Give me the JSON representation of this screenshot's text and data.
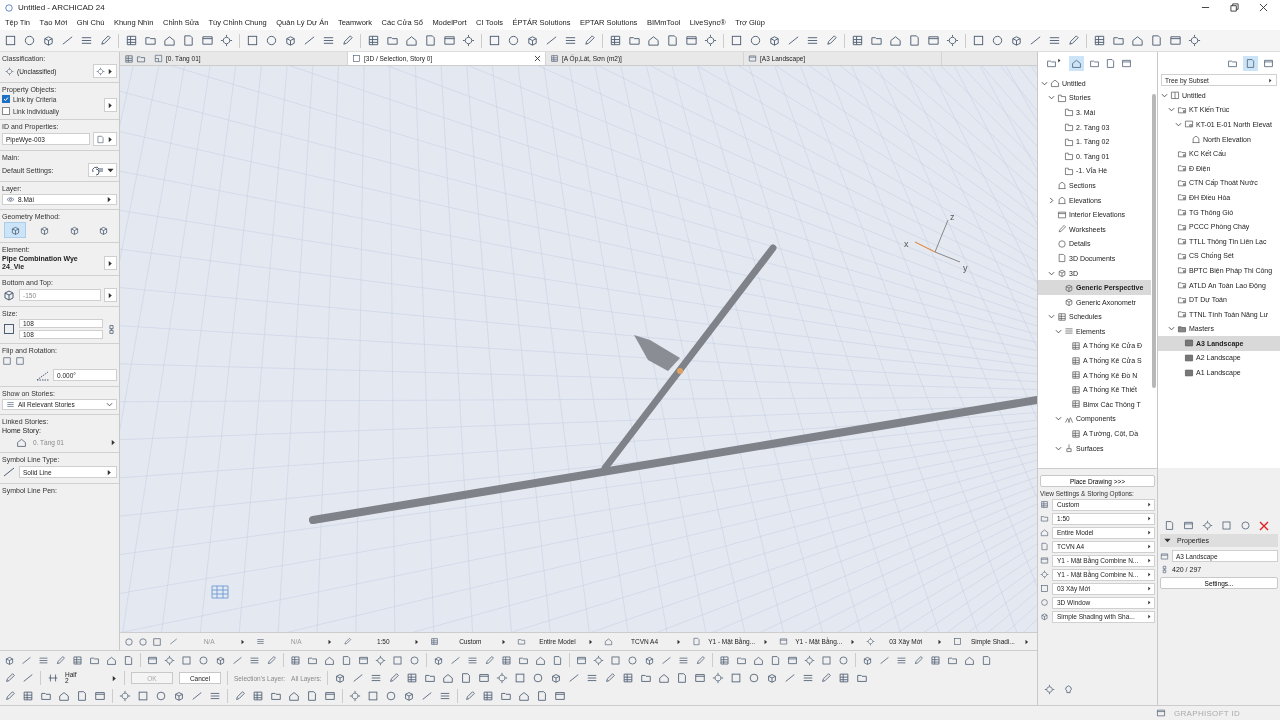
{
  "window": {
    "title": "Untitled - ARCHICAD 24"
  },
  "menu": [
    "Tệp Tin",
    "Tạo Mới",
    "Ghi Chú",
    "Khung Nhìn",
    "Chỉnh Sửa",
    "Tùy Chỉnh Chung",
    "Quản Lý Dự Án",
    "Teamwork",
    "Các Cửa Sổ",
    "ModelPort",
    "CI Tools",
    "ÉPTÁR Solutions",
    "EPTAR Solutions",
    "BIMmTool",
    "LiveSync®",
    "Trợ Giúp"
  ],
  "view_tabs": [
    {
      "label": "[0. Tầng 01]",
      "kind": "plan",
      "selected": false
    },
    {
      "label": "[3D / Selection, Story 0]",
      "kind": "perspective",
      "selected": true
    },
    {
      "label": "[A Ốp,Lát, Sơn (m2)]",
      "kind": "schedule",
      "selected": false
    },
    {
      "label": "[A3 Landscape]",
      "kind": "layout",
      "selected": false
    }
  ],
  "info_box": {
    "classification_label": "Classification:",
    "classification_value": "(Unclassified)",
    "property_objects_label": "Property Objects:",
    "links": [
      {
        "label": "Link by Criteria",
        "checked": true
      },
      {
        "label": "Link Individually",
        "checked": false
      }
    ],
    "id_label": "ID and Properties:",
    "id_value": "PipeWye-003",
    "main_label": "Main:",
    "default_settings_label": "Default Settings:",
    "layer_label": "Layer:",
    "layer_value": "8.Mái",
    "geometry_label": "Geometry Method:",
    "geometry_methods": [
      {
        "selected": true
      },
      {
        "selected": false
      },
      {
        "selected": false
      },
      {
        "selected": false
      }
    ],
    "element_label": "Element:",
    "element_value": "Pipe Combination Wye 24_Vie",
    "bottom_top_label": "Bottom and Top:",
    "bottom_top_value": "-150",
    "size_label": "Size:",
    "size_values": [
      "108",
      "108"
    ],
    "flip_label": "Flip and Rotation:",
    "rotation_value": "0.000°",
    "show_on_stories_label": "Show on Stories:",
    "show_on_stories_value": "All Relevant Stories",
    "linked_stories_label": "Linked Stories:",
    "home_story_label": "Home Story:",
    "home_story_value": "0. Tầng 01",
    "symbol_line_type_label": "Symbol Line Type:",
    "symbol_line_type_value": "Solid Line",
    "symbol_line_pen_label": "Symbol Line Pen:"
  },
  "viewport": {
    "axis_labels": [
      "z",
      "x",
      "y"
    ]
  },
  "quick_options": [
    "N/A",
    "N/A",
    "1:50",
    "Custom",
    "Entire Model",
    "TCVN A4",
    "Y1 - Mặt Bằng...",
    "Y1 - Mặt Bằng...",
    "03 Xây Mới",
    "Simple Shadi..."
  ],
  "pen_option": {
    "label": "Half",
    "value": "2"
  },
  "confirm_buttons": [
    {
      "label": "OK",
      "disabled": true
    },
    {
      "label": "Cancel",
      "disabled": false
    }
  ],
  "layer_labels": [
    "Selection's Layer:",
    "All Layers:"
  ],
  "navigator": {
    "tree": [
      {
        "label": "Untitled",
        "kind": "project",
        "expanded": true,
        "selected": false,
        "children": [
          {
            "label": "Stories",
            "kind": "story",
            "expanded": true,
            "selected": false,
            "children": [
              {
                "label": "3. Mái",
                "kind": "story",
                "selected": false
              },
              {
                "label": "2. Tầng 03",
                "kind": "story",
                "selected": false
              },
              {
                "label": "1. Tầng 02",
                "kind": "story",
                "selected": false
              },
              {
                "label": "0. Tầng 01",
                "kind": "story",
                "selected": false
              },
              {
                "label": "-1. Vỉa Hè",
                "kind": "story",
                "selected": false
              }
            ]
          },
          {
            "label": "Sections",
            "kind": "section",
            "selected": false
          },
          {
            "label": "Elevations",
            "kind": "section",
            "expanded": false,
            "selected": false
          },
          {
            "label": "Interior Elevations",
            "kind": "interior",
            "selected": false
          },
          {
            "label": "Worksheets",
            "kind": "worksheet",
            "selected": false
          },
          {
            "label": "Details",
            "kind": "detail",
            "selected": false
          },
          {
            "label": "3D Documents",
            "kind": "document",
            "selected": false
          },
          {
            "label": "3D",
            "kind": "cube",
            "expanded": true,
            "selected": false,
            "children": [
              {
                "label": "Generic Perspective",
                "kind": "cube",
                "selected": true
              },
              {
                "label": "Generic Axonometr",
                "kind": "cube",
                "selected": false
              }
            ]
          },
          {
            "label": "Schedules",
            "kind": "schedule",
            "expanded": true,
            "selected": false,
            "children": [
              {
                "label": "Elements",
                "kind": "elements",
                "expanded": true,
                "selected": false,
                "children": [
                  {
                    "label": "A Thống Kê Cửa Đ",
                    "kind": "schedule",
                    "selected": false
                  },
                  {
                    "label": "A Thống Kê Cửa S",
                    "kind": "schedule",
                    "selected": false
                  },
                  {
                    "label": "A Thống Kê Đồ N",
                    "kind": "schedule",
                    "selected": false
                  },
                  {
                    "label": "A Thống Kê Thiết",
                    "kind": "schedule",
                    "selected": false
                  },
                  {
                    "label": "Bimx Các Thông T",
                    "kind": "schedule",
                    "selected": false
                  }
                ]
              },
              {
                "label": "Components",
                "kind": "components",
                "expanded": true,
                "selected": false,
                "children": [
                  {
                    "label": "A Tường, Cột, Dầ",
                    "kind": "schedule",
                    "selected": false
                  }
                ]
              },
              {
                "label": "Surfaces",
                "kind": "surfaces",
                "expanded": true,
                "selected": false
              }
            ]
          }
        ]
      }
    ],
    "place_drawing": "Place Drawing >>>",
    "view_settings_label": "View Settings & Storing Options:",
    "view_settings": [
      "Custom",
      "1:50",
      "Entire Model",
      "TCVN A4",
      "Y1 - Mặt Bằng Combine N...",
      "Y1 - Mặt Bằng Combine N...",
      "03 Xây Mới",
      "3D Window",
      "Simple Shading with Sha..."
    ]
  },
  "organizer": {
    "subset_mode": "Tree by Subset",
    "tree": [
      {
        "label": "Untitled",
        "kind": "book",
        "expanded": true,
        "selected": false,
        "children": [
          {
            "label": "KT Kiến Trúc",
            "kind": "subset",
            "expanded": true,
            "selected": false,
            "children": [
              {
                "label": "KT-01 E-01 North Elevat",
                "kind": "sheet",
                "expanded": true,
                "selected": false,
                "children": [
                  {
                    "label": "North Elevation",
                    "kind": "section",
                    "selected": false
                  }
                ]
              }
            ]
          },
          {
            "label": "KC Kết Cấu",
            "kind": "subset",
            "selected": false
          },
          {
            "label": "Đ Điện",
            "kind": "subset",
            "selected": false
          },
          {
            "label": "CTN Cấp Thoát Nước",
            "kind": "subset",
            "selected": false
          },
          {
            "label": "ĐH Điều Hòa",
            "kind": "subset",
            "selected": false
          },
          {
            "label": "TG Thông Gió",
            "kind": "subset",
            "selected": false
          },
          {
            "label": "PCCC Phòng Cháy",
            "kind": "subset",
            "selected": false
          },
          {
            "label": "TTLL Thông Tin Liên Lạc",
            "kind": "subset",
            "selected": false
          },
          {
            "label": "CS Chống Sét",
            "kind": "subset",
            "selected": false
          },
          {
            "label": "BPTC Biện Pháp Thi Công",
            "kind": "subset",
            "selected": false
          },
          {
            "label": "ATLD An Toàn Lao Động",
            "kind": "subset",
            "selected": false
          },
          {
            "label": "DT Dự Toán",
            "kind": "subset",
            "selected": false
          },
          {
            "label": "TTNL Tính Toán Năng Lư",
            "kind": "subset",
            "selected": false
          },
          {
            "label": "Masters",
            "kind": "masters",
            "expanded": true,
            "selected": false,
            "children": [
              {
                "label": "A3 Landscape",
                "kind": "master",
                "selected": true
              },
              {
                "label": "A2 Landscape",
                "kind": "master",
                "selected": false
              },
              {
                "label": "A1 Landscape",
                "kind": "master",
                "selected": false
              }
            ]
          }
        ]
      }
    ],
    "properties": {
      "title": "Properties",
      "expanded": true,
      "name": "A3 Landscape",
      "size": "420 / 297",
      "settings_button": "Settings..."
    }
  },
  "status_bar": {
    "account": "GRAPHISOFT ID"
  }
}
